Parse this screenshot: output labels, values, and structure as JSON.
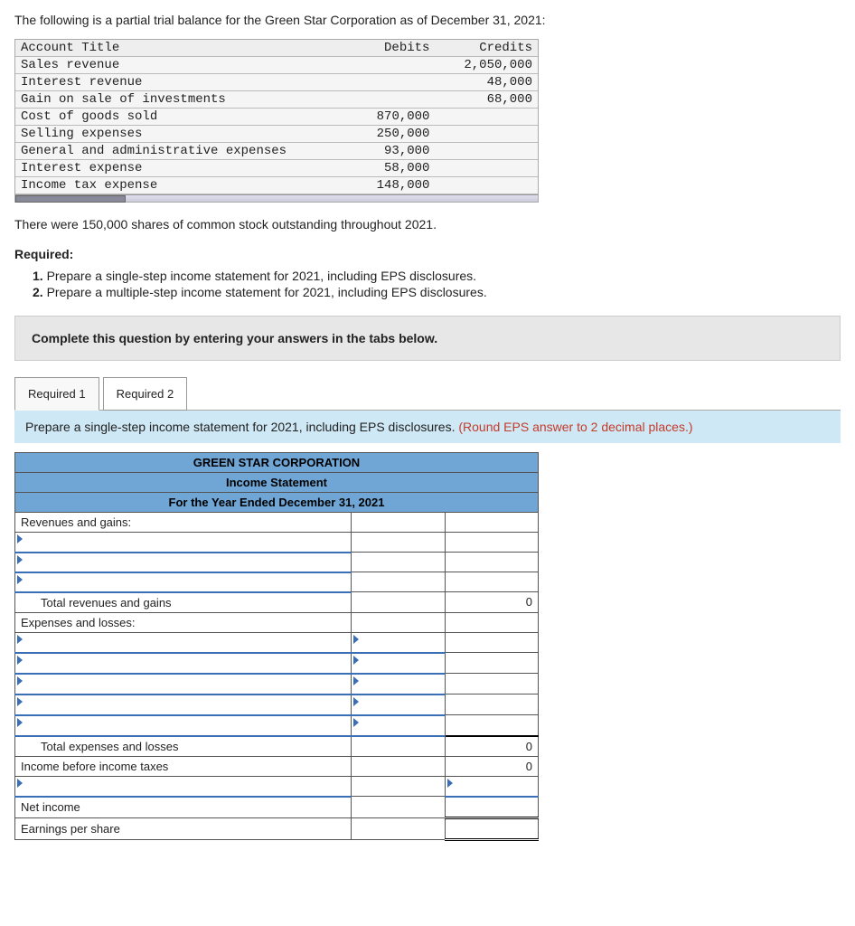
{
  "intro": "The following is a partial trial balance for the Green Star Corporation as of December 31, 2021:",
  "trial_balance": {
    "headers": {
      "title": "Account Title",
      "debits": "Debits",
      "credits": "Credits"
    },
    "rows": [
      {
        "title": "Sales revenue",
        "debit": "",
        "credit": "2,050,000"
      },
      {
        "title": "Interest revenue",
        "debit": "",
        "credit": "48,000"
      },
      {
        "title": "Gain on sale of investments",
        "debit": "",
        "credit": "68,000"
      },
      {
        "title": "Cost of goods sold",
        "debit": "870,000",
        "credit": ""
      },
      {
        "title": "Selling expenses",
        "debit": "250,000",
        "credit": ""
      },
      {
        "title": "General and administrative expenses",
        "debit": "93,000",
        "credit": ""
      },
      {
        "title": "Interest expense",
        "debit": "58,000",
        "credit": ""
      },
      {
        "title": "Income tax expense",
        "debit": "148,000",
        "credit": ""
      }
    ]
  },
  "shares_note": "There were 150,000 shares of common stock outstanding throughout 2021.",
  "required_heading": "Required:",
  "requirements": [
    "Prepare a single-step income statement for 2021, including EPS disclosures.",
    "Prepare a multiple-step income statement for 2021, including EPS disclosures."
  ],
  "banner": "Complete this question by entering your answers in the tabs below.",
  "tabs": {
    "r1": "Required 1",
    "r2": "Required 2"
  },
  "instruction": {
    "main": "Prepare a single-step income statement for 2021, including EPS disclosures. ",
    "hint": "(Round EPS answer to 2 decimal places.)"
  },
  "worksheet": {
    "title1": "GREEN STAR CORPORATION",
    "title2": "Income Statement",
    "title3": "For the Year Ended December 31, 2021",
    "rows": {
      "rev_gains": "Revenues and gains:",
      "total_rev": "Total revenues and gains",
      "total_rev_val": "0",
      "exp_loss": "Expenses and losses:",
      "total_exp": "Total expenses and losses",
      "total_exp_val": "0",
      "inc_before": "Income before income taxes",
      "inc_before_val": "0",
      "net_income": "Net income",
      "eps": "Earnings per share"
    }
  }
}
